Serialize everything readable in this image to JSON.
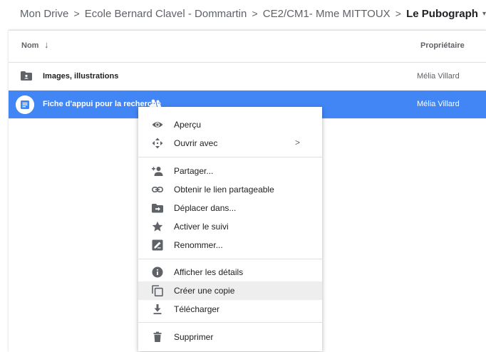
{
  "breadcrumb": {
    "items": [
      "Mon Drive",
      "Ecole Bernard Clavel - Dommartin",
      "CE2/CM1- Mme MITTOUX",
      "Le Pubograph"
    ],
    "separator": ">",
    "caret": "▾"
  },
  "list": {
    "header": {
      "name": "Nom",
      "sort_arrow": "↓",
      "owner": "Propriétaire"
    },
    "rows": [
      {
        "name": "Images, illustrations",
        "owner": "Mélia Villard",
        "type": "shared-folder"
      },
      {
        "name": "Fiche d'appui pour la recherche",
        "owner": "Mélia Villard",
        "type": "google-doc",
        "shared": true,
        "selected": true
      }
    ]
  },
  "context_menu": {
    "items": [
      {
        "label": "Aperçu",
        "icon": "eye-icon"
      },
      {
        "label": "Ouvrir avec",
        "icon": "move-arrows-icon",
        "submenu": ">"
      },
      {
        "label": "Partager...",
        "icon": "add-person-icon"
      },
      {
        "label": "Obtenir le lien partageable",
        "icon": "link-icon"
      },
      {
        "label": "Déplacer dans...",
        "icon": "move-folder-icon"
      },
      {
        "label": "Activer le suivi",
        "icon": "star-icon"
      },
      {
        "label": "Renommer...",
        "icon": "rename-icon"
      },
      {
        "label": "Afficher les détails",
        "icon": "info-icon"
      },
      {
        "label": "Créer une copie",
        "icon": "copy-icon",
        "highlighted": true
      },
      {
        "label": "Télécharger",
        "icon": "download-icon"
      },
      {
        "label": "Supprimer",
        "icon": "trash-icon"
      }
    ]
  },
  "colors": {
    "selection": "#4285f4",
    "icon_gray": "#5f6368",
    "doc_blue": "#4285f4",
    "hover": "#eeeeee"
  }
}
